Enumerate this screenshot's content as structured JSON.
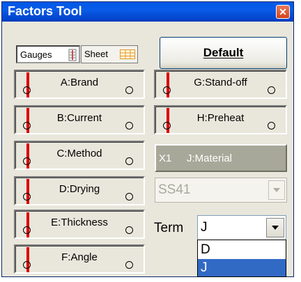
{
  "window": {
    "title": "Factors Tool",
    "close_glyph": "✕"
  },
  "toolbar": {
    "gauges_label": "Gauges",
    "sheet_label": "Sheet",
    "default_label": "Default"
  },
  "factors_left": [
    "A:Brand",
    "B:Current",
    "C:Method",
    "D:Drying",
    "E:Thickness",
    "F:Angle"
  ],
  "factors_right": [
    "G:Stand-off",
    "H:Preheat"
  ],
  "material": {
    "tag": "X1",
    "label": "J:Material"
  },
  "material_select": {
    "value": "SS41"
  },
  "term": {
    "label": "Term",
    "value": "J",
    "options": [
      "D",
      "J"
    ],
    "selected": "J"
  },
  "colors": {
    "title_bar": "#0a5ce8",
    "gauge_line": "#e00000",
    "selection": "#316ac5",
    "material_bg": "#a8a89a"
  }
}
